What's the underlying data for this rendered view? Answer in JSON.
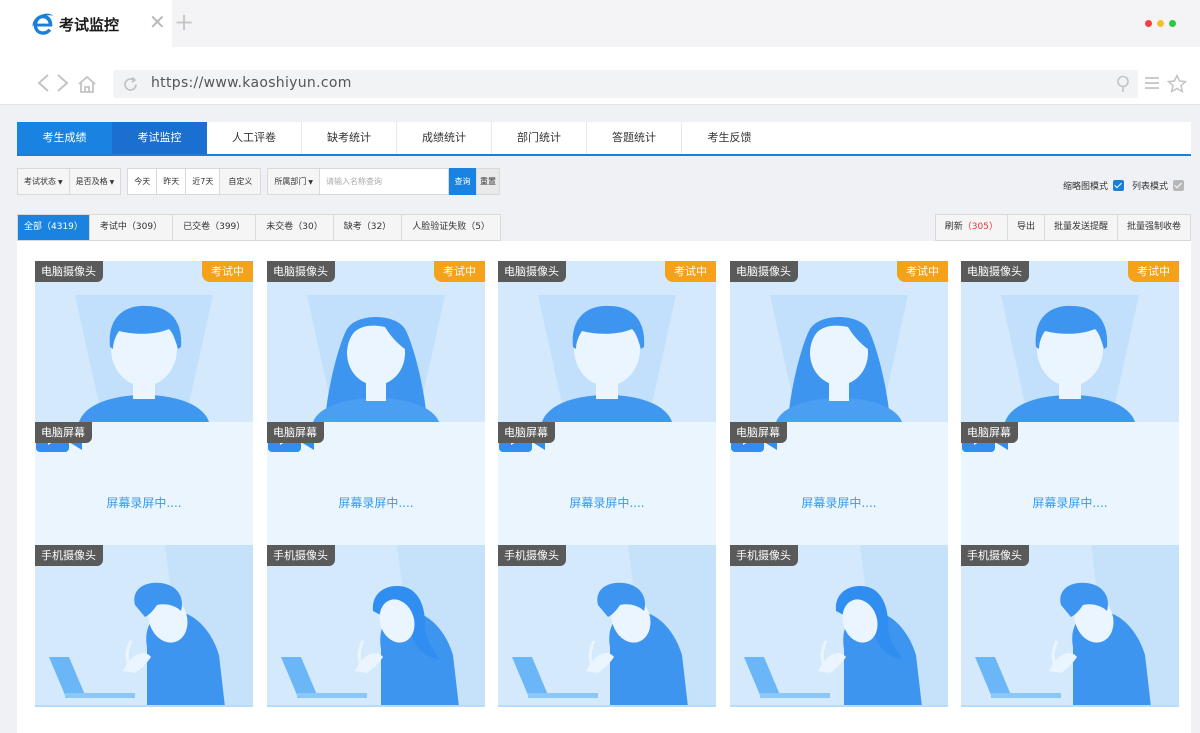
{
  "browser": {
    "tab_title": "考试监控",
    "url": "https://www.kaoshiyun.com",
    "window_dot_colors": [
      "#f5413b",
      "#f5c02a",
      "#2bc840"
    ]
  },
  "main_nav": [
    {
      "label": "考生成绩"
    },
    {
      "label": "考试监控"
    },
    {
      "label": "人工评卷"
    },
    {
      "label": "缺考统计"
    },
    {
      "label": "成绩统计"
    },
    {
      "label": "部门统计"
    },
    {
      "label": "答题统计"
    },
    {
      "label": "考生反馈"
    }
  ],
  "filters": {
    "exam_status": "考试状态",
    "pass_status": "是否及格",
    "today": "今天",
    "yesterday": "昨天",
    "last7": "近7天",
    "custom": "自定义",
    "department": "所属部门",
    "search_placeholder": "请输入名称查询",
    "search_btn": "查询",
    "reset_btn": "重置"
  },
  "view_modes": {
    "thumbnail": "缩略图模式",
    "list": "列表模式"
  },
  "status_tabs": [
    {
      "label": "全部（4319）"
    },
    {
      "label": "考试中（309）"
    },
    {
      "label": "已交卷（399）"
    },
    {
      "label": "未交卷（30）"
    },
    {
      "label": "缺考（32）"
    },
    {
      "label": "人脸验证失败（5）"
    }
  ],
  "actions": {
    "refresh": "刷新",
    "refresh_count": "（305）",
    "export": "导出",
    "batch_remind": "批量发送提醒",
    "batch_force": "批量强制收卷"
  },
  "cards": [
    {
      "cam_label": "电脑摄像头",
      "status": "考试中",
      "screen_label": "电脑屏幕",
      "screen_text": "屏幕录屏中....",
      "phone_label": "手机摄像头",
      "avatar": "male"
    },
    {
      "cam_label": "电脑摄像头",
      "status": "考试中",
      "screen_label": "电脑屏幕",
      "screen_text": "屏幕录屏中....",
      "phone_label": "手机摄像头",
      "avatar": "female"
    },
    {
      "cam_label": "电脑摄像头",
      "status": "考试中",
      "screen_label": "电脑屏幕",
      "screen_text": "屏幕录屏中....",
      "phone_label": "手机摄像头",
      "avatar": "male"
    },
    {
      "cam_label": "电脑摄像头",
      "status": "考试中",
      "screen_label": "电脑屏幕",
      "screen_text": "屏幕录屏中....",
      "phone_label": "手机摄像头",
      "avatar": "female"
    },
    {
      "cam_label": "电脑摄像头",
      "status": "考试中",
      "screen_label": "电脑屏幕",
      "screen_text": "屏幕录屏中....",
      "phone_label": "手机摄像头",
      "avatar": "male"
    }
  ]
}
